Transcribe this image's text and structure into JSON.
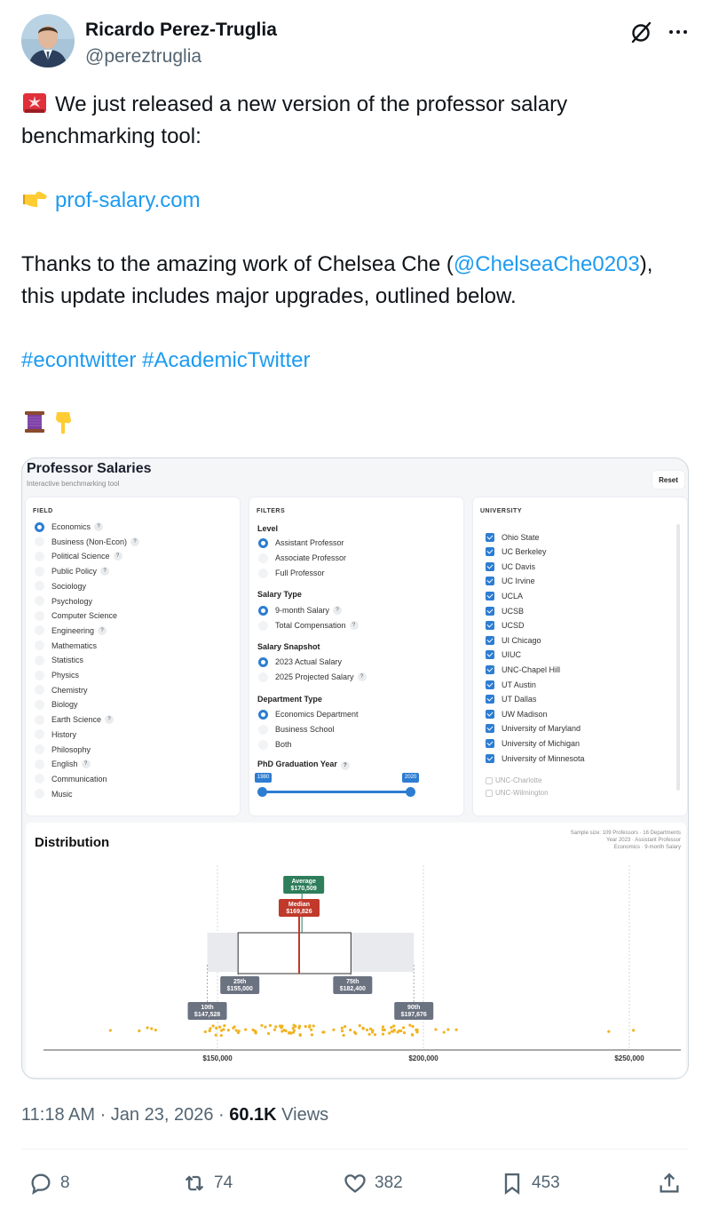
{
  "author": {
    "name": "Ricardo Perez-Truglia",
    "handle": "@pereztruglia"
  },
  "tweet": {
    "line1": "We just released a new version of the professor salary benchmarking tool:",
    "link": "prof-salary.com",
    "thanks_pre": "Thanks to the amazing work of Chelsea Che (",
    "mention": "@ChelseaChe0203",
    "thanks_post": "), this update includes major upgrades, outlined below.",
    "hashtag1": "#econtwitter",
    "hashtag2": "#AcademicTwitter"
  },
  "app": {
    "title": "Professor Salaries",
    "subtitle": "Interactive benchmarking tool",
    "reset": "Reset",
    "field": {
      "heading": "FIELD",
      "items": [
        {
          "label": "Economics",
          "help": "?",
          "selected": true
        },
        {
          "label": "Business (Non-Econ)",
          "help": "?"
        },
        {
          "label": "Political Science",
          "help": "?"
        },
        {
          "label": "Public Policy",
          "help": "?"
        },
        {
          "label": "Sociology"
        },
        {
          "label": "Psychology"
        },
        {
          "label": "Computer Science"
        },
        {
          "label": "Engineering",
          "help": "?"
        },
        {
          "label": "Mathematics"
        },
        {
          "label": "Statistics"
        },
        {
          "label": "Physics"
        },
        {
          "label": "Chemistry"
        },
        {
          "label": "Biology"
        },
        {
          "label": "Earth Science",
          "help": "?"
        },
        {
          "label": "History"
        },
        {
          "label": "Philosophy"
        },
        {
          "label": "English",
          "help": "?"
        },
        {
          "label": "Communication"
        },
        {
          "label": "Music"
        }
      ]
    },
    "filters": {
      "heading": "FILTERS",
      "level": {
        "label": "Level",
        "options": [
          "Assistant Professor",
          "Associate Professor",
          "Full Professor"
        ]
      },
      "salary_type": {
        "label": "Salary Type",
        "options": [
          "9-month Salary",
          "Total Compensation"
        ],
        "help": "?"
      },
      "snapshot": {
        "label": "Salary Snapshot",
        "options": [
          "2023 Actual Salary",
          "2025 Projected Salary"
        ],
        "help": "?"
      },
      "dept": {
        "label": "Department Type",
        "options": [
          "Economics Department",
          "Business School",
          "Both"
        ]
      },
      "phd": {
        "label": "PhD Graduation Year",
        "help": "?",
        "from": "1980",
        "to": "2020"
      }
    },
    "university": {
      "heading": "UNIVERSITY",
      "checked": [
        "Ohio State",
        "UC Berkeley",
        "UC Davis",
        "UC Irvine",
        "UCLA",
        "UCSB",
        "UCSD",
        "UI Chicago",
        "UIUC",
        "UNC-Chapel Hill",
        "UT Austin",
        "UT Dallas",
        "UW Madison",
        "University of Maryland",
        "University of Michigan",
        "University of Minnesota"
      ],
      "unchecked": [
        "UNC-Charlotte",
        "UNC-Wilmington"
      ]
    },
    "distribution": {
      "title": "Distribution",
      "meta1": "Sample size: 109 Professors · 16 Departments",
      "meta2": "Year 2023 · Assistant Professor",
      "meta3": "Economics · 9-month Salary",
      "stats": {
        "p10": {
          "label": "10th",
          "value": "$147,528",
          "num": 147528
        },
        "p25": {
          "label": "25th",
          "value": "$155,000",
          "num": 155000
        },
        "median": {
          "label": "Median",
          "value": "$169,826",
          "num": 169826
        },
        "average": {
          "label": "Average",
          "value": "$170,509",
          "num": 170509
        },
        "p75": {
          "label": "75th",
          "value": "$182,400",
          "num": 182400
        },
        "p90": {
          "label": "90th",
          "value": "$197,676",
          "num": 197676
        }
      },
      "ticks": [
        {
          "label": "$150,000",
          "value": 150000
        },
        {
          "label": "$200,000",
          "value": 200000
        },
        {
          "label": "$250,000",
          "value": 250000
        }
      ],
      "colors": {
        "average": "#2e7d5b",
        "median": "#c0392b",
        "pct": "#6b7280",
        "dot": "#f1b320"
      }
    }
  },
  "meta": {
    "time": "11:18 AM · Jan 23, 2026 · ",
    "views": "60.1K",
    "views_label": " Views"
  },
  "actions": {
    "replies": "8",
    "reposts": "74",
    "likes": "382",
    "bookmarks": "453"
  }
}
